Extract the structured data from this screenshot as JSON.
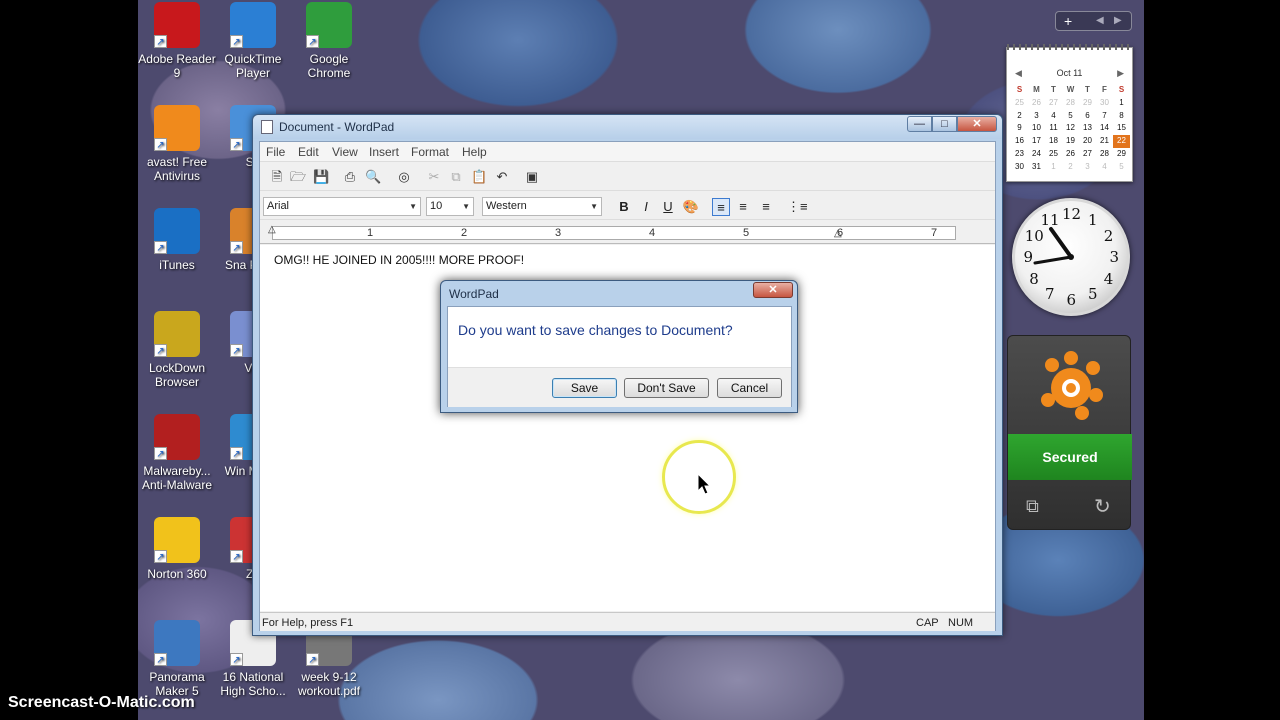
{
  "desktop_icons": [
    {
      "label": "Adobe Reader 9",
      "icon": "adobe-reader-icon",
      "color": "#c8181c"
    },
    {
      "label": "QuickTime Player",
      "icon": "quicktime-icon",
      "color": "#2b7fd4"
    },
    {
      "label": "Google Chrome",
      "icon": "chrome-icon",
      "color": "#2f9d3d"
    },
    {
      "label": "avast! Free Antivirus",
      "icon": "avast-icon",
      "color": "#f08a1c"
    },
    {
      "label": "Sa",
      "icon": "safari-icon",
      "color": "#4a90d9"
    },
    {
      "label": "iTunes",
      "icon": "itunes-icon",
      "color": "#1a6fc4"
    },
    {
      "label": "Sna Photo",
      "icon": "snapfish-icon",
      "color": "#d9822b"
    },
    {
      "label": "LockDown Browser",
      "icon": "lockdown-browser-icon",
      "color": "#c9a71d"
    },
    {
      "label": "Vie",
      "icon": "viewer-icon",
      "color": "#7a8fd0"
    },
    {
      "label": "Malwareby... Anti-Malware",
      "icon": "malwarebytes-icon",
      "color": "#b21f1f"
    },
    {
      "label": "Win Media",
      "icon": "windows-media-icon",
      "color": "#2e8bd0"
    },
    {
      "label": "Norton 360",
      "icon": "norton-icon",
      "color": "#f1c21b"
    },
    {
      "label": "Zo",
      "icon": "zoom-icon",
      "color": "#cc3333"
    },
    {
      "label": "Panorama Maker 5",
      "icon": "panorama-maker-icon",
      "color": "#3d78c0"
    },
    {
      "label": "16 National High Scho...",
      "icon": "pdf-file-icon",
      "color": "#eeeeee"
    },
    {
      "label": "week 9-12 workout.pdf",
      "icon": "pdf-file-icon",
      "color": "#777777"
    }
  ],
  "wordpad": {
    "title": "Document - WordPad",
    "menu": [
      "File",
      "Edit",
      "View",
      "Insert",
      "Format",
      "Help"
    ],
    "font_name": "Arial",
    "font_size": "10",
    "script": "Western",
    "format_buttons": {
      "bold": "B",
      "italic": "I",
      "underline": "U"
    },
    "ruler_numbers": [
      "1",
      "2",
      "3",
      "4",
      "5",
      "6",
      "7"
    ],
    "document_text": "OMG!! HE JOINED IN 2005!!!! MORE PROOF!",
    "status_help": "For Help, press F1",
    "status_cap": "CAP",
    "status_num": "NUM"
  },
  "dialog": {
    "title": "WordPad",
    "question": "Do you want to save changes to Document?",
    "buttons": {
      "save": "Save",
      "dont_save": "Don't Save",
      "cancel": "Cancel"
    }
  },
  "calendar": {
    "month": "Oct 11",
    "weekdays": [
      "S",
      "M",
      "T",
      "W",
      "T",
      "F",
      "S"
    ],
    "weeks": [
      [
        "25",
        "26",
        "27",
        "28",
        "29",
        "30",
        "1"
      ],
      [
        "2",
        "3",
        "4",
        "5",
        "6",
        "7",
        "8"
      ],
      [
        "9",
        "10",
        "11",
        "12",
        "13",
        "14",
        "15"
      ],
      [
        "16",
        "17",
        "18",
        "19",
        "20",
        "21",
        "22"
      ],
      [
        "23",
        "24",
        "25",
        "26",
        "27",
        "28",
        "29"
      ],
      [
        "30",
        "31",
        "1",
        "2",
        "3",
        "4",
        "5"
      ]
    ],
    "today": "22"
  },
  "clock": {
    "numbers": [
      "12",
      "1",
      "2",
      "3",
      "4",
      "5",
      "6",
      "7",
      "8",
      "9",
      "10",
      "11"
    ]
  },
  "avast_gadget": {
    "status": "Secured",
    "accent": "#2a9a2a"
  },
  "watermark": "Screencast-O-Matic.com"
}
